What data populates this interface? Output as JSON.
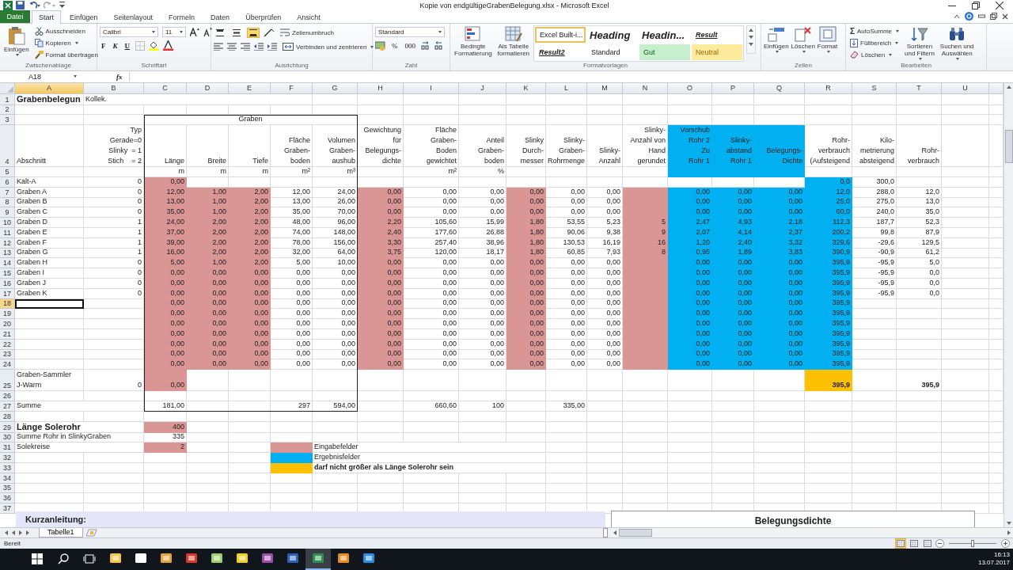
{
  "window": {
    "title": "Kopie von endgültigeGrabenBelegung.xlsx  -  Microsoft Excel"
  },
  "tabs": [
    {
      "label": "Datei",
      "kind": "file",
      "selected": false
    },
    {
      "label": "Start",
      "kind": "tab",
      "selected": true
    },
    {
      "label": "Einfügen",
      "kind": "tab",
      "selected": false
    },
    {
      "label": "Seitenlayout",
      "kind": "tab",
      "selected": false
    },
    {
      "label": "Formeln",
      "kind": "tab",
      "selected": false
    },
    {
      "label": "Daten",
      "kind": "tab",
      "selected": false
    },
    {
      "label": "Überprüfen",
      "kind": "tab",
      "selected": false
    },
    {
      "label": "Ansicht",
      "kind": "tab",
      "selected": false
    }
  ],
  "ribbon": {
    "clipboard": {
      "label": "Zwischenablage",
      "paste": "Einfügen",
      "cut": "Ausschneiden",
      "copy": "Kopieren",
      "format_painter": "Format übertragen"
    },
    "font": {
      "label": "Schriftart",
      "family": "Calibri",
      "size": "11",
      "bold": "F",
      "italic": "K",
      "underline": "U"
    },
    "alignment": {
      "label": "Ausrichtung",
      "wrap": "Zeilenumbruch",
      "merge": "Verbinden und zentrieren",
      "vertical": [
        {
          "selected": false
        },
        {
          "selected": false
        },
        {
          "selected": true
        }
      ]
    },
    "number": {
      "label": "Zahl",
      "format": "Standard",
      "percent": "%",
      "thousands": "000"
    },
    "styles": {
      "label": "Formatvorlagen",
      "conditional": "Bedingte\nFormatierung",
      "as_table": "Als Tabelle\nformatieren",
      "gallery": [
        {
          "label": "Excel Built-i...",
          "kind": "plain",
          "selected": true
        },
        {
          "label": "Heading",
          "kind": "heading",
          "selected": false
        },
        {
          "label": "Headin...",
          "kind": "heading",
          "selected": false
        },
        {
          "label": "Result",
          "kind": "result",
          "selected": false
        },
        {
          "label": "Result2",
          "kind": "result",
          "selected": false
        },
        {
          "label": "Standard",
          "kind": "plain",
          "selected": false
        },
        {
          "label": "Gut",
          "kind": "good",
          "selected": false
        },
        {
          "label": "Neutral",
          "kind": "neutral",
          "selected": false
        }
      ]
    },
    "cells": {
      "label": "Zellen",
      "insert": "Einfügen",
      "delete": "Löschen",
      "format": "Format"
    },
    "editing": {
      "label": "Bearbeiten",
      "autosum_symbol": "Σ",
      "autosum": "AutoSumme",
      "fill": "Füllbereich",
      "clear": "Löschen",
      "sort": "Sortieren\nund Filtern",
      "find": "Suchen und\nAuswählen"
    }
  },
  "formula_bar": {
    "name_box": "A18",
    "fx": "fx"
  },
  "sheet": {
    "columns": [
      {
        "label": "A",
        "selected": true
      },
      {
        "label": "B",
        "selected": false
      },
      {
        "label": "C",
        "selected": false
      },
      {
        "label": "D",
        "selected": false
      },
      {
        "label": "E",
        "selected": false
      },
      {
        "label": "F",
        "selected": false
      },
      {
        "label": "G",
        "selected": false
      },
      {
        "label": "H",
        "selected": false
      },
      {
        "label": "I",
        "selected": false
      },
      {
        "label": "J",
        "selected": false
      },
      {
        "label": "K",
        "selected": false
      },
      {
        "label": "L",
        "selected": false
      },
      {
        "label": "M",
        "selected": false
      },
      {
        "label": "N",
        "selected": false
      },
      {
        "label": "O",
        "selected": false
      },
      {
        "label": "P",
        "selected": false
      },
      {
        "label": "Q",
        "selected": false
      },
      {
        "label": "R",
        "selected": false
      },
      {
        "label": "S",
        "selected": false
      },
      {
        "label": "T",
        "selected": false
      },
      {
        "label": "U",
        "selected": false
      }
    ],
    "rows": [
      {
        "number": "1",
        "selected": false,
        "cells": [
          {
            "text": "Grabenbelegun",
            "bold": true,
            "large": true
          },
          {
            "text": "Kollek.",
            "kind": "label"
          }
        ]
      },
      {
        "number": "2",
        "selected": false,
        "cells": []
      },
      {
        "number": "3",
        "selected": false,
        "cells": [
          null,
          null,
          {
            "text": "Graben",
            "kind": "group-heading"
          }
        ]
      },
      {
        "number": "4",
        "selected": false,
        "cells": [
          "Abschnitt",
          "Typ\nGerade=0\nSlinky  = 1\nStich    = 2",
          "Länge",
          "Breite",
          "Tiefe",
          "Fläche\nGraben-\nboden",
          "Volumen\nGraben-\naushub",
          "Gewichtung\nfür\nBelegungs-\ndichte",
          "Fläche\nGraben-\nBoden\ngewichtet",
          "Anteil\nGraben-\nboden",
          "Slinky\nDurch-\nmesser",
          "Slinky-\nGraben-\nRohrmenge",
          "Slinky-\nAnzahl",
          "Slinky-\nAnzahl von\nHand\ngerundet",
          {
            "text": "Vorschub\nRohr 2\nZu\nRohr 1",
            "color": "#00b0f0"
          },
          {
            "text": "Slinky-\nabstand\nRohr 1",
            "color": "#00b0f0"
          },
          {
            "text": "Belegungs-\nDichte",
            "color": "#00b0f0"
          },
          "Rohr-\nverbrauch\n(Aufsteigend",
          "Kilo-\nmetrierung\nabsteigend",
          "Rohr-\nverbrauch"
        ]
      },
      {
        "number": "5",
        "selected": false,
        "cells": [
          null,
          null,
          "m",
          "m",
          "m",
          "m²",
          "m³",
          null,
          "m²",
          "%",
          null,
          null,
          null,
          null,
          {
            "color": "#00b0f0"
          },
          {
            "color": "#00b0f0"
          },
          {
            "color": "#00b0f0"
          }
        ]
      },
      {
        "number": "6",
        "selected": false,
        "cells": [
          "Kalt-A",
          "0",
          {
            "text": "0,00",
            "color": "#da9694"
          },
          null,
          null,
          null,
          null,
          null,
          null,
          null,
          null,
          null,
          null,
          null,
          null,
          null,
          null,
          {
            "text": "0,0",
            "color": "#00b0f0"
          },
          "300,0"
        ]
      },
      {
        "number": "7",
        "selected": false,
        "cells": [
          "Graben A",
          "0",
          {
            "text": "12,00",
            "color": "#da9694"
          },
          {
            "text": "1,00",
            "color": "#da9694"
          },
          {
            "text": "2,00",
            "color": "#da9694"
          },
          "12,00",
          "24,00",
          {
            "text": "0,00",
            "color": "#da9694"
          },
          "0,00",
          "0,00",
          {
            "text": "0,00",
            "color": "#da9694"
          },
          "0,00",
          "0,00",
          {
            "color": "#da9694"
          },
          {
            "text": "0,00",
            "color": "#00b0f0"
          },
          {
            "text": "0,00",
            "color": "#00b0f0"
          },
          {
            "text": "0,00",
            "color": "#00b0f0"
          },
          {
            "text": "12,0",
            "color": "#00b0f0"
          },
          "288,0",
          "12,0"
        ]
      },
      {
        "number": "8",
        "selected": false,
        "cells": [
          "Graben B",
          "0",
          {
            "text": "13,00",
            "color": "#da9694"
          },
          {
            "text": "1,00",
            "color": "#da9694"
          },
          {
            "text": "2,00",
            "color": "#da9694"
          },
          "13,00",
          "26,00",
          {
            "text": "0,00",
            "color": "#da9694"
          },
          "0,00",
          "0,00",
          {
            "text": "0,00",
            "color": "#da9694"
          },
          "0,00",
          "0,00",
          {
            "color": "#da9694"
          },
          {
            "text": "0,00",
            "color": "#00b0f0"
          },
          {
            "text": "0,00",
            "color": "#00b0f0"
          },
          {
            "text": "0,00",
            "color": "#00b0f0"
          },
          {
            "text": "25,0",
            "color": "#00b0f0"
          },
          "275,0",
          "13,0"
        ]
      },
      {
        "number": "9",
        "selected": false,
        "cells": [
          "Graben C",
          "0",
          {
            "text": "35,00",
            "color": "#da9694"
          },
          {
            "text": "1,00",
            "color": "#da9694"
          },
          {
            "text": "2,00",
            "color": "#da9694"
          },
          "35,00",
          "70,00",
          {
            "text": "0,00",
            "color": "#da9694"
          },
          "0,00",
          "0,00",
          {
            "text": "0,00",
            "color": "#da9694"
          },
          "0,00",
          "0,00",
          {
            "color": "#da9694"
          },
          {
            "text": "0,00",
            "color": "#00b0f0"
          },
          {
            "text": "0,00",
            "color": "#00b0f0"
          },
          {
            "text": "0,00",
            "color": "#00b0f0"
          },
          {
            "text": "60,0",
            "color": "#00b0f0"
          },
          "240,0",
          "35,0"
        ]
      },
      {
        "number": "10",
        "selected": false,
        "cells": [
          "Graben D",
          "1",
          {
            "text": "24,00",
            "color": "#da9694"
          },
          {
            "text": "2,00",
            "color": "#da9694"
          },
          {
            "text": "2,00",
            "color": "#da9694"
          },
          "48,00",
          "96,00",
          {
            "text": "2,20",
            "color": "#da9694"
          },
          "105,60",
          "15,99",
          {
            "text": "1,80",
            "color": "#da9694"
          },
          "53,55",
          "5,23",
          {
            "text": "5",
            "color": "#da9694"
          },
          {
            "text": "2,47",
            "color": "#00b0f0"
          },
          {
            "text": "4,93",
            "color": "#00b0f0"
          },
          {
            "text": "2,18",
            "color": "#00b0f0"
          },
          {
            "text": "112,3",
            "color": "#00b0f0"
          },
          "187,7",
          "52,3"
        ]
      },
      {
        "number": "11",
        "selected": false,
        "cells": [
          "Graben E",
          "1",
          {
            "text": "37,00",
            "color": "#da9694"
          },
          {
            "text": "2,00",
            "color": "#da9694"
          },
          {
            "text": "2,00",
            "color": "#da9694"
          },
          "74,00",
          "148,00",
          {
            "text": "2,40",
            "color": "#da9694"
          },
          "177,60",
          "26,88",
          {
            "text": "1,80",
            "color": "#da9694"
          },
          "90,06",
          "9,38",
          {
            "text": "9",
            "color": "#da9694"
          },
          {
            "text": "2,07",
            "color": "#00b0f0"
          },
          {
            "text": "4,14",
            "color": "#00b0f0"
          },
          {
            "text": "2,37",
            "color": "#00b0f0"
          },
          {
            "text": "200,2",
            "color": "#00b0f0"
          },
          "99,8",
          "87,9"
        ]
      },
      {
        "number": "12",
        "selected": false,
        "cells": [
          "Graben F",
          "1",
          {
            "text": "39,00",
            "color": "#da9694"
          },
          {
            "text": "2,00",
            "color": "#da9694"
          },
          {
            "text": "2,00",
            "color": "#da9694"
          },
          "78,00",
          "156,00",
          {
            "text": "3,30",
            "color": "#da9694"
          },
          "257,40",
          "38,96",
          {
            "text": "1,80",
            "color": "#da9694"
          },
          "130,53",
          "16,19",
          {
            "text": "16",
            "color": "#da9694"
          },
          {
            "text": "1,20",
            "color": "#00b0f0"
          },
          {
            "text": "2,40",
            "color": "#00b0f0"
          },
          {
            "text": "3,32",
            "color": "#00b0f0"
          },
          {
            "text": "329,6",
            "color": "#00b0f0"
          },
          "-29,6",
          "129,5"
        ]
      },
      {
        "number": "13",
        "selected": false,
        "cells": [
          "Graben G",
          "1",
          {
            "text": "16,00",
            "color": "#da9694"
          },
          {
            "text": "2,00",
            "color": "#da9694"
          },
          {
            "text": "2,00",
            "color": "#da9694"
          },
          "32,00",
          "64,00",
          {
            "text": "3,75",
            "color": "#da9694"
          },
          "120,00",
          "18,17",
          {
            "text": "1,80",
            "color": "#da9694"
          },
          "60,85",
          "7,93",
          {
            "text": "8",
            "color": "#da9694"
          },
          {
            "text": "0,95",
            "color": "#00b0f0"
          },
          {
            "text": "1,89",
            "color": "#00b0f0"
          },
          {
            "text": "3,83",
            "color": "#00b0f0"
          },
          {
            "text": "390,9",
            "color": "#00b0f0"
          },
          "-90,9",
          "61,2"
        ]
      },
      {
        "number": "14",
        "selected": false,
        "cells": [
          "Graben H",
          "0",
          {
            "text": "5,00",
            "color": "#da9694"
          },
          {
            "text": "1,00",
            "color": "#da9694"
          },
          {
            "text": "2,00",
            "color": "#da9694"
          },
          "5,00",
          "10,00",
          {
            "text": "0,00",
            "color": "#da9694"
          },
          "0,00",
          "0,00",
          {
            "text": "0,00",
            "color": "#da9694"
          },
          "0,00",
          "0,00",
          {
            "color": "#da9694"
          },
          {
            "text": "0,00",
            "color": "#00b0f0"
          },
          {
            "text": "0,00",
            "color": "#00b0f0"
          },
          {
            "text": "0,00",
            "color": "#00b0f0"
          },
          {
            "text": "395,9",
            "color": "#00b0f0"
          },
          "-95,9",
          "5,0"
        ]
      },
      {
        "number": "15",
        "selected": false,
        "cells": [
          "Graben I",
          "0",
          {
            "text": "0,00",
            "color": "#da9694"
          },
          {
            "text": "0,00",
            "color": "#da9694"
          },
          {
            "text": "0,00",
            "color": "#da9694"
          },
          "0,00",
          "0,00",
          {
            "text": "0,00",
            "color": "#da9694"
          },
          "0,00",
          "0,00",
          {
            "text": "0,00",
            "color": "#da9694"
          },
          "0,00",
          "0,00",
          {
            "color": "#da9694"
          },
          {
            "text": "0,00",
            "color": "#00b0f0"
          },
          {
            "text": "0,00",
            "color": "#00b0f0"
          },
          {
            "text": "0,00",
            "color": "#00b0f0"
          },
          {
            "text": "395,9",
            "color": "#00b0f0"
          },
          "-95,9",
          "0,0"
        ]
      },
      {
        "number": "16",
        "selected": false,
        "cells": [
          "Graben J",
          "0",
          {
            "text": "0,00",
            "color": "#da9694"
          },
          {
            "text": "0,00",
            "color": "#da9694"
          },
          {
            "text": "0,00",
            "color": "#da9694"
          },
          "0,00",
          "0,00",
          {
            "text": "0,00",
            "color": "#da9694"
          },
          "0,00",
          "0,00",
          {
            "text": "0,00",
            "color": "#da9694"
          },
          "0,00",
          "0,00",
          {
            "color": "#da9694"
          },
          {
            "text": "0,00",
            "color": "#00b0f0"
          },
          {
            "text": "0,00",
            "color": "#00b0f0"
          },
          {
            "text": "0,00",
            "color": "#00b0f0"
          },
          {
            "text": "395,9",
            "color": "#00b0f0"
          },
          "-95,9",
          "0,0"
        ]
      },
      {
        "number": "17",
        "selected": false,
        "cells": [
          "Graben K",
          "0",
          {
            "text": "0,00",
            "color": "#da9694"
          },
          {
            "text": "0,00",
            "color": "#da9694"
          },
          {
            "text": "0,00",
            "color": "#da9694"
          },
          "0,00",
          "0,00",
          {
            "text": "0,00",
            "color": "#da9694"
          },
          "0,00",
          "0,00",
          {
            "text": "0,00",
            "color": "#da9694"
          },
          "0,00",
          "0,00",
          {
            "color": "#da9694"
          },
          {
            "text": "0,00",
            "color": "#00b0f0"
          },
          {
            "text": "0,00",
            "color": "#00b0f0"
          },
          {
            "text": "0,00",
            "color": "#00b0f0"
          },
          {
            "text": "395,9",
            "color": "#00b0f0"
          },
          "-95,9",
          "0,0"
        ]
      },
      {
        "number": "18",
        "selected": true,
        "cells": [
          null,
          null,
          {
            "text": "0,00",
            "color": "#da9694"
          },
          {
            "text": "0,00",
            "color": "#da9694"
          },
          {
            "text": "0,00",
            "color": "#da9694"
          },
          "0,00",
          "0,00",
          {
            "text": "0,00",
            "color": "#da9694"
          },
          "0,00",
          "0,00",
          {
            "text": "0,00",
            "color": "#da9694"
          },
          "0,00",
          "0,00",
          {
            "color": "#da9694"
          },
          {
            "text": "0,00",
            "color": "#00b0f0"
          },
          {
            "text": "0,00",
            "color": "#00b0f0"
          },
          {
            "text": "0,00",
            "color": "#00b0f0"
          },
          {
            "text": "395,9",
            "color": "#00b0f0"
          }
        ]
      },
      {
        "number": "19",
        "selected": false,
        "cells": [
          null,
          null,
          {
            "text": "0,00",
            "color": "#da9694"
          },
          {
            "text": "0,00",
            "color": "#da9694"
          },
          {
            "text": "0,00",
            "color": "#da9694"
          },
          "0,00",
          "0,00",
          {
            "text": "0,00",
            "color": "#da9694"
          },
          "0,00",
          "0,00",
          {
            "text": "0,00",
            "color": "#da9694"
          },
          "0,00",
          "0,00",
          {
            "color": "#da9694"
          },
          {
            "text": "0,00",
            "color": "#00b0f0"
          },
          {
            "text": "0,00",
            "color": "#00b0f0"
          },
          {
            "text": "0,00",
            "color": "#00b0f0"
          },
          {
            "text": "395,9",
            "color": "#00b0f0"
          }
        ]
      },
      {
        "number": "20",
        "selected": false,
        "cells": [
          null,
          null,
          {
            "text": "0,00",
            "color": "#da9694"
          },
          {
            "text": "0,00",
            "color": "#da9694"
          },
          {
            "text": "0,00",
            "color": "#da9694"
          },
          "0,00",
          "0,00",
          {
            "text": "0,00",
            "color": "#da9694"
          },
          "0,00",
          "0,00",
          {
            "text": "0,00",
            "color": "#da9694"
          },
          "0,00",
          "0,00",
          {
            "color": "#da9694"
          },
          {
            "text": "0,00",
            "color": "#00b0f0"
          },
          {
            "text": "0,00",
            "color": "#00b0f0"
          },
          {
            "text": "0,00",
            "color": "#00b0f0"
          },
          {
            "text": "395,9",
            "color": "#00b0f0"
          }
        ]
      },
      {
        "number": "21",
        "selected": false,
        "cells": [
          null,
          null,
          {
            "text": "0,00",
            "color": "#da9694"
          },
          {
            "text": "0,00",
            "color": "#da9694"
          },
          {
            "text": "0,00",
            "color": "#da9694"
          },
          "0,00",
          "0,00",
          {
            "text": "0,00",
            "color": "#da9694"
          },
          "0,00",
          "0,00",
          {
            "text": "0,00",
            "color": "#da9694"
          },
          "0,00",
          "0,00",
          {
            "color": "#da9694"
          },
          {
            "text": "0,00",
            "color": "#00b0f0"
          },
          {
            "text": "0,00",
            "color": "#00b0f0"
          },
          {
            "text": "0,00",
            "color": "#00b0f0"
          },
          {
            "text": "395,9",
            "color": "#00b0f0"
          }
        ]
      },
      {
        "number": "22",
        "selected": false,
        "cells": [
          null,
          null,
          {
            "text": "0,00",
            "color": "#da9694"
          },
          {
            "text": "0,00",
            "color": "#da9694"
          },
          {
            "text": "0,00",
            "color": "#da9694"
          },
          "0,00",
          "0,00",
          {
            "text": "0,00",
            "color": "#da9694"
          },
          "0,00",
          "0,00",
          {
            "text": "0,00",
            "color": "#da9694"
          },
          "0,00",
          "0,00",
          {
            "color": "#da9694"
          },
          {
            "text": "0,00",
            "color": "#00b0f0"
          },
          {
            "text": "0,00",
            "color": "#00b0f0"
          },
          {
            "text": "0,00",
            "color": "#00b0f0"
          },
          {
            "text": "395,9",
            "color": "#00b0f0"
          }
        ]
      },
      {
        "number": "23",
        "selected": false,
        "cells": [
          null,
          null,
          {
            "text": "0,00",
            "color": "#da9694"
          },
          {
            "text": "0,00",
            "color": "#da9694"
          },
          {
            "text": "0,00",
            "color": "#da9694"
          },
          "0,00",
          "0,00",
          {
            "text": "0,00",
            "color": "#da9694"
          },
          "0,00",
          "0,00",
          {
            "text": "0,00",
            "color": "#da9694"
          },
          "0,00",
          "0,00",
          {
            "color": "#da9694"
          },
          {
            "text": "0,00",
            "color": "#00b0f0"
          },
          {
            "text": "0,00",
            "color": "#00b0f0"
          },
          {
            "text": "0,00",
            "color": "#00b0f0"
          },
          {
            "text": "395,9",
            "color": "#00b0f0"
          }
        ]
      },
      {
        "number": "24",
        "selected": false,
        "cells": [
          null,
          null,
          {
            "text": "0,00",
            "color": "#da9694"
          },
          {
            "text": "0,00",
            "color": "#da9694"
          },
          {
            "text": "0,00",
            "color": "#da9694"
          },
          "0,00",
          "0,00",
          {
            "text": "0,00",
            "color": "#da9694"
          },
          "0,00",
          "0,00",
          {
            "text": "0,00",
            "color": "#da9694"
          },
          "0,00",
          "0,00",
          {
            "color": "#da9694"
          },
          {
            "text": "0,00",
            "color": "#00b0f0"
          },
          {
            "text": "0,00",
            "color": "#00b0f0"
          },
          {
            "text": "0,00",
            "color": "#00b0f0"
          },
          {
            "text": "395,9",
            "color": "#00b0f0"
          }
        ]
      },
      {
        "number": "25",
        "selected": false,
        "cells": [
          "Graben-Sammler\nJ-Warm",
          "0",
          {
            "text": "0,00",
            "color": "#da9694"
          },
          null,
          null,
          null,
          null,
          null,
          null,
          null,
          null,
          null,
          null,
          null,
          null,
          null,
          null,
          {
            "text": "395,9",
            "color": "#ffc000",
            "bold": true
          },
          null,
          {
            "text": "395,9",
            "bold": true
          }
        ]
      },
      {
        "number": "26",
        "selected": false,
        "cells": []
      },
      {
        "number": "27",
        "selected": false,
        "cells": [
          "Summe",
          null,
          "181,00",
          null,
          null,
          "297",
          "594,00",
          null,
          "660,60",
          "100",
          null,
          "335,00"
        ]
      },
      {
        "number": "28",
        "selected": false,
        "cells": []
      },
      {
        "number": "29",
        "selected": false,
        "cells": [
          {
            "text": "Länge Solerohr",
            "bold": true,
            "large": true
          },
          null,
          {
            "text": "400",
            "color": "#da9694"
          }
        ]
      },
      {
        "number": "30",
        "selected": false,
        "cells": [
          "Summe Rohr in SlinkyGraben",
          null,
          "335"
        ]
      },
      {
        "number": "31",
        "selected": false,
        "cells": [
          "Solekreise",
          null,
          {
            "text": "2",
            "color": "#da9694"
          },
          null,
          null,
          {
            "color": "#da9694"
          },
          {
            "text": "Eingabefelder",
            "kind": "label"
          }
        ]
      },
      {
        "number": "32",
        "selected": false,
        "cells": [
          null,
          null,
          null,
          null,
          null,
          {
            "color": "#00b0f0"
          },
          {
            "text": "Ergebnisfelder",
            "kind": "label"
          }
        ]
      },
      {
        "number": "33",
        "selected": false,
        "cells": [
          null,
          null,
          null,
          null,
          null,
          {
            "color": "#ffc000"
          },
          {
            "text": "darf nicht größer als Länge Solerohr sein",
            "kind": "label",
            "bold": true
          }
        ]
      },
      {
        "number": "34",
        "selected": false,
        "cells": []
      },
      {
        "number": "35",
        "selected": false,
        "cells": []
      },
      {
        "number": "36",
        "selected": false,
        "cells": []
      },
      {
        "number": "37",
        "selected": false,
        "cells": []
      }
    ],
    "text_box": "Kurzanleitung:",
    "chart": {
      "title": "Belegungsdichte"
    }
  },
  "sheet_tabs": [
    {
      "label": "Tabelle1",
      "selected": true
    }
  ],
  "status_bar": {
    "text": "Bereit",
    "views": [
      {
        "selected": true
      },
      {
        "selected": false
      },
      {
        "selected": false
      }
    ],
    "zoom": {
      "level": 0.5
    }
  },
  "taskbar": {
    "apps": [
      {
        "active": false
      },
      {
        "active": false
      },
      {
        "active": false
      },
      {
        "active": false
      },
      {
        "active": false
      },
      {
        "active": false
      },
      {
        "active": false
      },
      {
        "active": false
      },
      {
        "active": true
      },
      {
        "active": false
      },
      {
        "active": false
      }
    ],
    "time": "16:13",
    "date": "13.07.2017"
  }
}
